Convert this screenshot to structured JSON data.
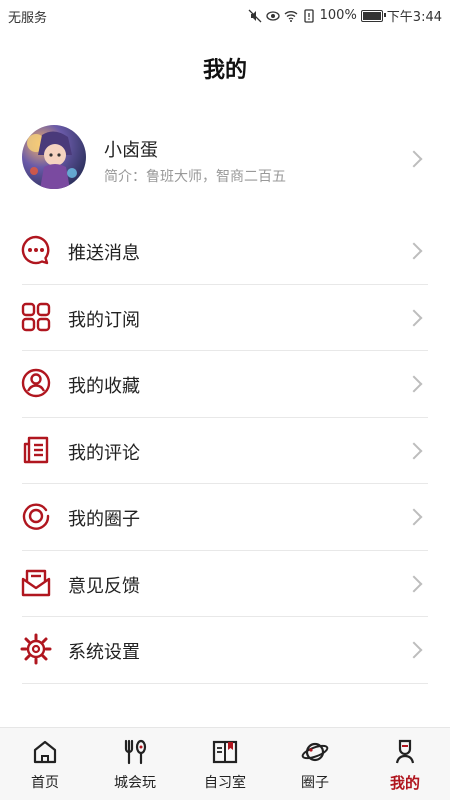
{
  "status_bar": {
    "carrier": "无服务",
    "battery": "100%",
    "time": "下午3:44"
  },
  "header": {
    "title": "我的"
  },
  "profile": {
    "name": "小卤蛋",
    "bio": "简介：鲁班大师，智商二百五"
  },
  "menu": {
    "items": [
      {
        "label": "推送消息",
        "icon": "message-icon"
      },
      {
        "label": "我的订阅",
        "icon": "grid-icon"
      },
      {
        "label": "我的收藏",
        "icon": "user-circle-icon"
      },
      {
        "label": "我的评论",
        "icon": "document-icon"
      },
      {
        "label": "我的圈子",
        "icon": "circle-icon"
      },
      {
        "label": "意见反馈",
        "icon": "mail-icon"
      },
      {
        "label": "系统设置",
        "icon": "gear-icon"
      }
    ]
  },
  "bottom_nav": {
    "items": [
      {
        "label": "首页",
        "icon": "home-icon"
      },
      {
        "label": "城会玩",
        "icon": "fork-spoon-icon"
      },
      {
        "label": "自习室",
        "icon": "book-icon"
      },
      {
        "label": "圈子",
        "icon": "planet-icon"
      },
      {
        "label": "我的",
        "icon": "person-icon"
      }
    ],
    "active": "我的"
  },
  "colors": {
    "accent": "#b0161f",
    "text": "#222222",
    "muted": "#999999"
  }
}
